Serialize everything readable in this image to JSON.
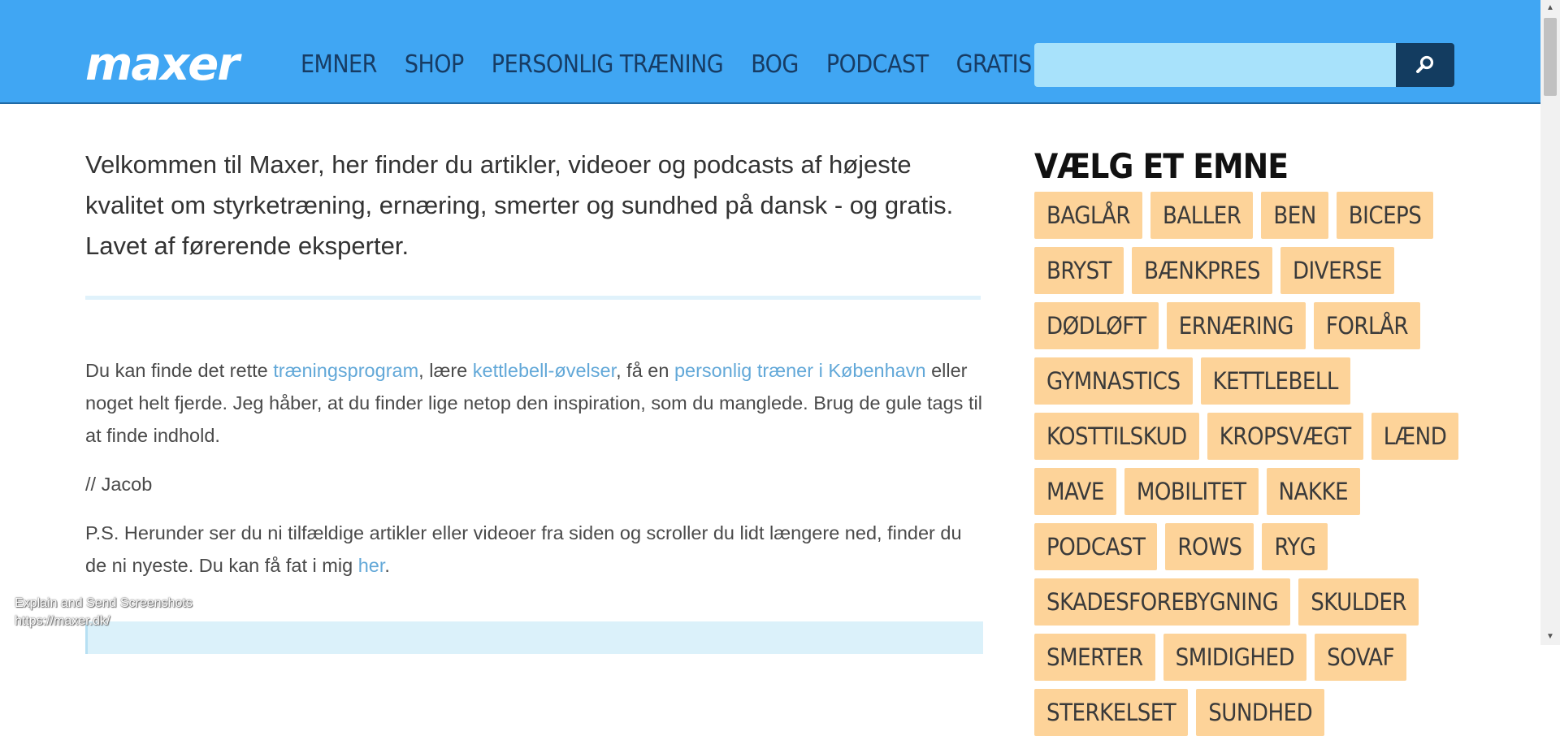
{
  "header": {
    "logo": "maxer",
    "nav": [
      "EMNER",
      "SHOP",
      "PERSONLIG TRÆNING",
      "BOG",
      "PODCAST",
      "GRATIS E-BOG"
    ],
    "search": {
      "value": "",
      "placeholder": ""
    },
    "icons": {
      "search": "search-icon"
    }
  },
  "main": {
    "intro": "Velkommen til Maxer, her finder du artikler, videoer og podcasts af højeste kvalitet om styrketræning, ernæring, smerter og sundhed på dansk - og gratis. Lavet af førerende eksperter.",
    "p1": {
      "t1": "Du kan finde det rette ",
      "link1": "træningsprogram",
      "t2": ", lære ",
      "link2": "kettlebell-øvelser",
      "t3": ", få en ",
      "link3": "personlig træner i København",
      "t4": " eller noget helt fjerde. Jeg håber, at du finder lige netop den inspiration, som du manglede. Brug de gule tags til at finde indhold."
    },
    "signature": "// Jacob",
    "p2": {
      "t1": "P.S. Herunder ser du ni tilfældige artikler eller videoer fra siden og scroller du lidt længere ned, finder du de ni nyeste. Du kan få fat i mig ",
      "link": "her",
      "t2": "."
    }
  },
  "overlay": {
    "line1": "Explain and Send Screenshots",
    "line2": "https://maxer.dk/"
  },
  "sidebar": {
    "title": "VÆLG ET EMNE",
    "tags": [
      "BAGLÅR",
      "BALLER",
      "BEN",
      "BICEPS",
      "BRYST",
      "BÆNKPRES",
      "DIVERSE",
      "DØDLØFT",
      "ERNÆRING",
      "FORLÅR",
      "GYMNASTICS",
      "KETTLEBELL",
      "KOSTTILSKUD",
      "KROPSVÆGT",
      "LÆND",
      "MAVE",
      "MOBILITET",
      "NAKKE",
      "PODCAST",
      "ROWS",
      "RYG",
      "SKADESFOREBYGNING",
      "SKULDER",
      "SMERTER",
      "SMIDIGHED",
      "SOVAF",
      "STERKELSET",
      "SUNDHED"
    ]
  },
  "colors": {
    "header_bg": "#40a6f3",
    "nav_text": "#173c64",
    "search_input_bg": "#a8e2fb",
    "search_button_bg": "#133c60",
    "tag_bg": "#fdd399",
    "link": "#62a8d8",
    "divider": "#e0f2fb",
    "promo_bg": "#dbf1fa"
  }
}
